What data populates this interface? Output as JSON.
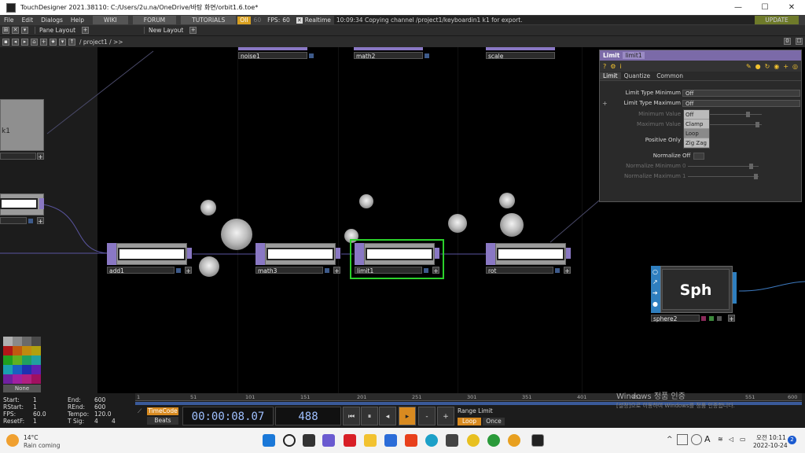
{
  "window": {
    "title": "TouchDesigner 2021.38110: C:/Users/2u.na/OneDrive/바탕 화면/orbit1.6.toe*",
    "controls": [
      "—",
      "☐",
      "✕"
    ]
  },
  "menubar": {
    "items": [
      "File",
      "Edit",
      "Dialogs",
      "Help"
    ],
    "links": [
      "WIKI",
      "FORUM",
      "TUTORIALS"
    ],
    "oi_label": "OII",
    "fps_dim": "60",
    "fps_label": "FPS:",
    "fps_value": "60",
    "realtime_label": "Realtime",
    "status": "10:09:34 Copying channel /project1/keyboardin1 k1 for export.",
    "update_label": "UPDATE"
  },
  "panebar": {
    "pane_layout": "Pane Layout",
    "new_layout": "New Layout"
  },
  "pathbar": {
    "path": "/ project1 / >>",
    "right_value": "0"
  },
  "network": {
    "top_nodes": [
      "noise1",
      "math2",
      "scale"
    ],
    "chain_nodes": [
      "add1",
      "math3",
      "limit1",
      "rot"
    ],
    "sphere_name": "sphere2",
    "sphere_label": "Sph",
    "left_stub": "k1"
  },
  "params": {
    "op_type": "Limit",
    "op_name": "limit1",
    "tabs": [
      "Limit",
      "Quantize",
      "Common"
    ],
    "rows": {
      "limit_type_min": {
        "label": "Limit Type Minimum",
        "value": "Off"
      },
      "limit_type_max": {
        "label": "Limit Type Maximum",
        "value": "Off"
      },
      "minimum_value": {
        "label": "Minimum Value"
      },
      "maximum_value": {
        "label": "Maximum Value"
      },
      "positive_only": {
        "label": "Positive Only"
      },
      "normalize": {
        "label": "Normalize",
        "value": "Off"
      },
      "normalize_min": {
        "label": "Normalize Minimum",
        "value": "0"
      },
      "normalize_max": {
        "label": "Normalize Maximum",
        "value": "1"
      }
    },
    "dropdown_options": [
      "Off",
      "Clamp",
      "Loop",
      "Zig Zag"
    ]
  },
  "palette": {
    "none_label": "None"
  },
  "timeline": {
    "start_label": "Start:",
    "start": "1",
    "end_label": "End:",
    "end": "600",
    "rstart_label": "RStart:",
    "rstart": "1",
    "rend_label": "REnd:",
    "rend": "600",
    "fps_label": "FPS:",
    "fps": "60.0",
    "tempo_label": "Tempo:",
    "tempo": "120.0",
    "resetf_label": "ResetF:",
    "resetf": "1",
    "tsig_label": "T Sig:",
    "tsig_a": "4",
    "tsig_b": "4",
    "timecode_label": "TimeCode",
    "beats_label": "Beats",
    "timecode": "00:00:08.07",
    "frame": "488",
    "range_label": "Range Limit",
    "loop_label": "Loop",
    "once_label": "Once",
    "ruler": [
      "1",
      "51",
      "101",
      "151",
      "201",
      "251",
      "301",
      "351",
      "401",
      "451",
      "551",
      "600"
    ]
  },
  "watermark": {
    "line1": "Windows 정품 인증",
    "line2": "[설정]으로 이동하여 Windows를 정품 인증합니다."
  },
  "taskbar": {
    "weather_temp": "14°C",
    "weather_desc": "Rain coming",
    "tray_ime": "A",
    "time": "오전 10:11",
    "date": "2022-10-24",
    "notif": "2"
  }
}
